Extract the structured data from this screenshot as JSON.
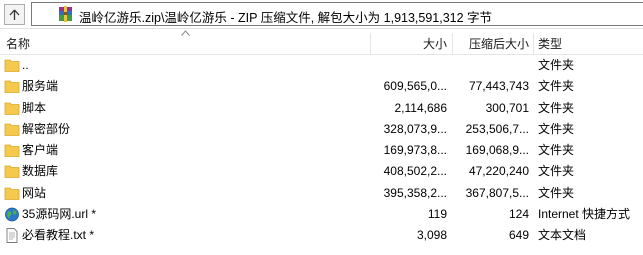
{
  "address": {
    "path": "温岭亿游乐.zip\\温岭亿游乐 - ZIP 压缩文件, 解包大小为 1,913,591,312 字节",
    "icon": "winrar-archive-icon"
  },
  "columns": {
    "name": "名称",
    "size": "大小",
    "packed": "压缩后大小",
    "type": "类型"
  },
  "rows": [
    {
      "name": "..",
      "size": "",
      "packed": "",
      "type": "文件夹",
      "icon": "folder-icon"
    },
    {
      "name": "服务端",
      "size": "609,565,0...",
      "packed": "77,443,743",
      "type": "文件夹",
      "icon": "folder-icon"
    },
    {
      "name": "脚本",
      "size": "2,114,686",
      "packed": "300,701",
      "type": "文件夹",
      "icon": "folder-icon"
    },
    {
      "name": "解密部份",
      "size": "328,073,9...",
      "packed": "253,506,7...",
      "type": "文件夹",
      "icon": "folder-icon"
    },
    {
      "name": "客户端",
      "size": "169,973,8...",
      "packed": "169,068,9...",
      "type": "文件夹",
      "icon": "folder-icon"
    },
    {
      "name": "数据库",
      "size": "408,502,2...",
      "packed": "47,220,240",
      "type": "文件夹",
      "icon": "folder-icon"
    },
    {
      "name": "网站",
      "size": "395,358,2...",
      "packed": "367,807,5...",
      "type": "文件夹",
      "icon": "folder-icon"
    },
    {
      "name": "35源码网.url *",
      "size": "119",
      "packed": "124",
      "type": "Internet 快捷方式",
      "icon": "globe-icon"
    },
    {
      "name": "必看教程.txt *",
      "size": "3,098",
      "packed": "649",
      "type": "文本文档",
      "icon": "text-file-icon"
    }
  ],
  "colors": {
    "folder": "#f4c94e",
    "folder_dark": "#d9a92b",
    "border": "#7a7a7a"
  }
}
